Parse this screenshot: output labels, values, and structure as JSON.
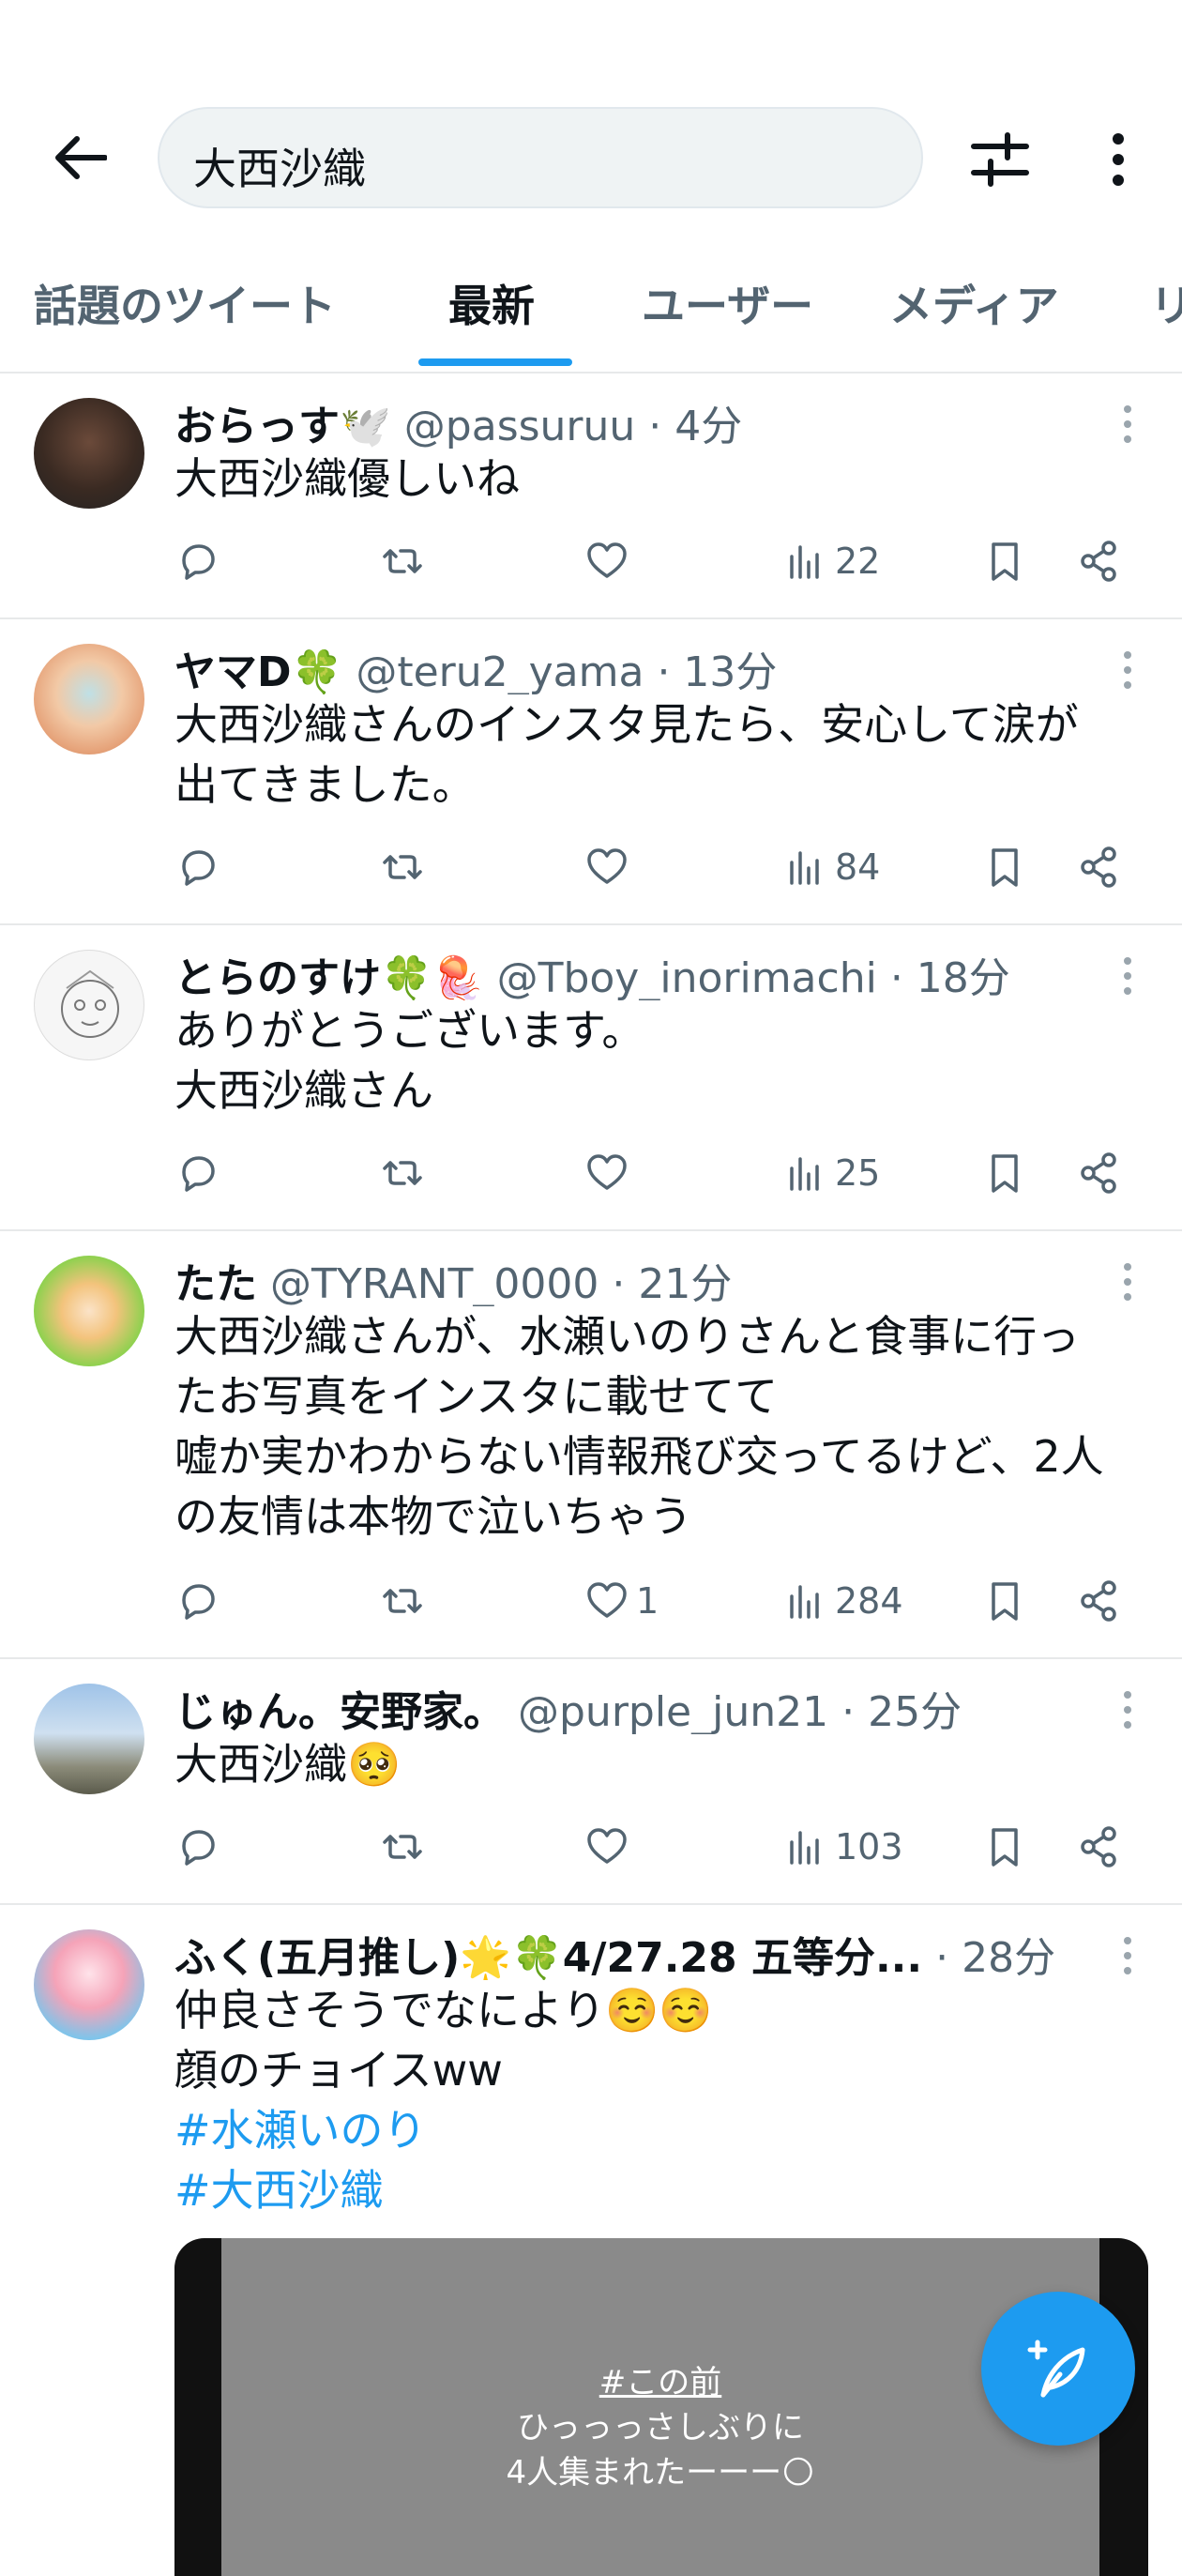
{
  "header": {
    "search_query": "大西沙織",
    "tabs": [
      "話題のツイート",
      "最新",
      "ユーザー",
      "メディア",
      "リ"
    ],
    "active_tab": "最新"
  },
  "tweets": [
    {
      "name": "おらっす",
      "name_emoji": "🕊️",
      "handle": "@passuruu",
      "time": "· 4分",
      "lines": [
        "大西沙織優しいね"
      ],
      "views": "22",
      "likes": ""
    },
    {
      "name": "ヤマD",
      "name_emoji": "🍀",
      "handle": "@teru2_yama",
      "time": "· 13分",
      "lines": [
        "大西沙織さんのインスタ見たら、安心して涙が",
        "出てきました。"
      ],
      "views": "84",
      "likes": ""
    },
    {
      "name": "とらのすけ",
      "name_emoji": "🍀🪼",
      "handle": "@Tboy_inorimachi",
      "time": "· 18分",
      "lines": [
        "ありがとうございます。",
        "大西沙織さん"
      ],
      "views": "25",
      "likes": ""
    },
    {
      "name": "たた",
      "name_emoji": "",
      "handle": "@TYRANT_0000",
      "time": "· 21分",
      "lines": [
        "大西沙織さんが、水瀬いのりさんと食事に行っ",
        "たお写真をインスタに載せてて",
        "嘘か実かわからない情報飛び交ってるけど、2人",
        "の友情は本物で泣いちゃう"
      ],
      "views": "284",
      "likes": "1"
    },
    {
      "name": "じゅん。安野家。",
      "name_emoji": "",
      "handle": "@purple_jun21",
      "time": "· 25分",
      "lines": [
        "大西沙織🥺"
      ],
      "views": "103",
      "likes": ""
    },
    {
      "name": "ふく(五月推し)🌟🍀4/27.28 五等分...",
      "name_emoji": "",
      "handle": "",
      "time": "· 28分",
      "lines": [
        "仲良さそうでなにより☺️☺️",
        "顔のチョイスww"
      ],
      "hashtags": [
        "#水瀬いのり",
        "#大西沙織"
      ]
    }
  ],
  "media": {
    "caption_tag": "#この前",
    "caption_line1": "ひっっっさしぶりに",
    "caption_line2": "4人集まれたーーー🌕"
  },
  "colors": {
    "accent": "#1d9bf0",
    "text": "#0f1419",
    "muted": "#536471",
    "divider": "#e7e9ea"
  }
}
